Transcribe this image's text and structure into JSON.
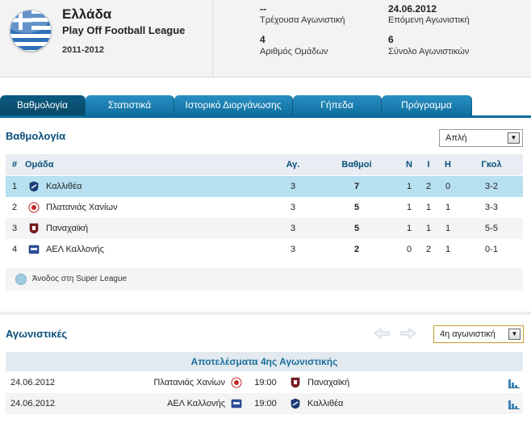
{
  "header": {
    "country": "Ελλάδα",
    "league": "Play Off Football League",
    "season": "2011-2012",
    "current_round_value": "--",
    "current_round_label": "Τρέχουσα Αγωνιστική",
    "next_round_value": "24.06.2012",
    "next_round_label": "Επόμενη Αγωνιστική",
    "teams_count_value": "4",
    "teams_count_label": "Αριθμός Ομάδων",
    "total_rounds_value": "6",
    "total_rounds_label": "Σύνολο Αγωνιστικών"
  },
  "tabs": [
    {
      "label": "Βαθμολογία",
      "active": true
    },
    {
      "label": "Στατιστικά",
      "active": false
    },
    {
      "label": "Ιστορικό Διοργάνωσης",
      "active": false
    },
    {
      "label": "Γήπεδα",
      "active": false
    },
    {
      "label": "Πρόγραμμα",
      "active": false
    }
  ],
  "standings": {
    "title": "Βαθμολογία",
    "view_select": "Απλή",
    "headers": {
      "pos": "#",
      "team": "Ομάδα",
      "played": "Αγ.",
      "points": "Βαθμοί",
      "w": "Ν",
      "d": "Ι",
      "l": "Η",
      "goals": "Γκολ"
    },
    "rows": [
      {
        "pos": "1",
        "team": "Καλλιθέα",
        "played": "3",
        "points": "7",
        "w": "1",
        "d": "2",
        "l": "0",
        "goals": "3-2"
      },
      {
        "pos": "2",
        "team": "Πλατανιάς Χανίων",
        "played": "3",
        "points": "5",
        "w": "1",
        "d": "1",
        "l": "1",
        "goals": "3-3"
      },
      {
        "pos": "3",
        "team": "Παναχαϊκή",
        "played": "3",
        "points": "5",
        "w": "1",
        "d": "1",
        "l": "1",
        "goals": "5-5"
      },
      {
        "pos": "4",
        "team": "ΑΕΛ Καλλονής",
        "played": "3",
        "points": "2",
        "w": "0",
        "d": "2",
        "l": "1",
        "goals": "0-1"
      }
    ],
    "legend": "Άνοδος στη Super League"
  },
  "fixtures": {
    "title": "Αγωνιστικές",
    "round_select": "4η αγωνιστική",
    "results_header": "Αποτελέσματα 4ης Αγωνιστικής",
    "matches": [
      {
        "date": "24.06.2012",
        "home": "Πλατανιάς Χανίων",
        "time": "19:00",
        "away": "Παναχαϊκή"
      },
      {
        "date": "24.06.2012",
        "home": "ΑΕΛ Καλλονής",
        "time": "19:00",
        "away": "Καλλιθέα"
      }
    ]
  },
  "colors": {
    "accent": "#0e6f9f",
    "highlight_row": "#b7e0f0",
    "section_title": "#0a4f7a"
  }
}
